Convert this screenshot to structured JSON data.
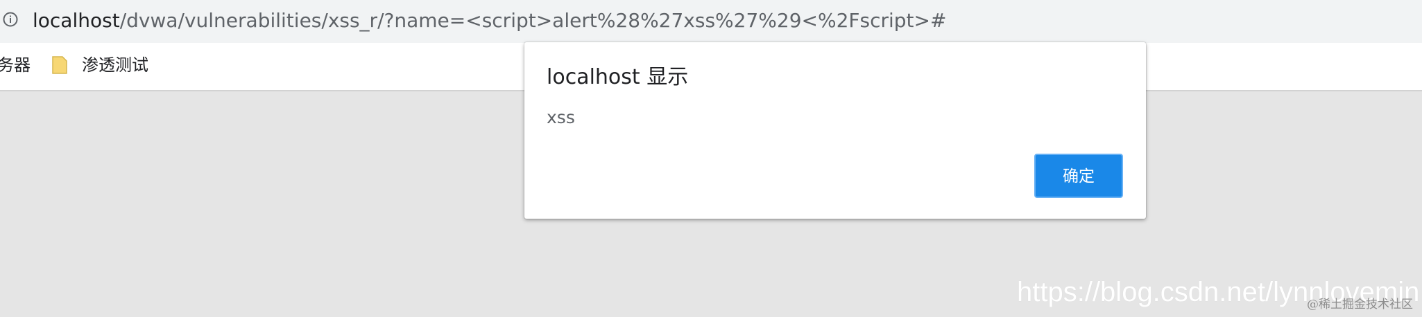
{
  "browser": {
    "url_host": "localhost",
    "url_path": "/dvwa/vulnerabilities/xss_r/?name=<script>alert%28%27xss%27%29<%2Fscript>#"
  },
  "bookmarks": {
    "partial_label": "务器",
    "folder_label": "渗透测试"
  },
  "dialog": {
    "title": "localhost 显示",
    "message": "xss",
    "ok_label": "确定"
  },
  "watermarks": {
    "csdn": "https://blog.csdn.net/lynnlovemin",
    "juejin": "@稀土掘金技术社区"
  },
  "colors": {
    "address_bar_bg": "#f1f3f4",
    "page_bg": "#e5e5e5",
    "button_accent": "#1a88e8",
    "folder_yellow": "#f7d774"
  },
  "icons": {
    "info": "info-icon",
    "folder": "folder-icon"
  }
}
